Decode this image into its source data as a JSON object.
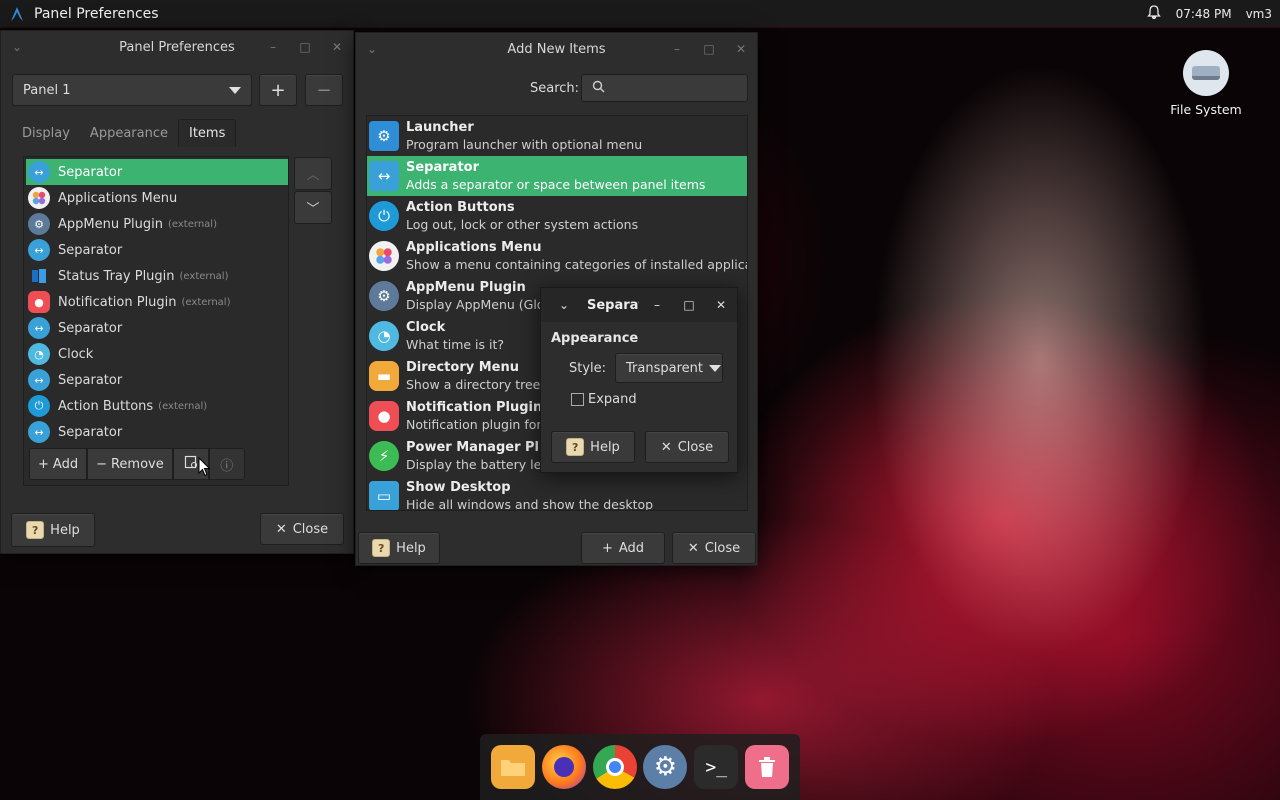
{
  "top_panel": {
    "app_title": "Panel Preferences",
    "clock": "07:48 PM",
    "user": "vm3"
  },
  "desktop": {
    "icon_label": "File System"
  },
  "panel_prefs": {
    "title": "Panel Preferences",
    "panel_select": "Panel 1",
    "tabs": [
      "Display",
      "Appearance",
      "Items"
    ],
    "items": [
      {
        "label": "Separator",
        "ext": ""
      },
      {
        "label": "Applications Menu",
        "ext": ""
      },
      {
        "label": "AppMenu Plugin",
        "ext": "(external)"
      },
      {
        "label": "Separator",
        "ext": ""
      },
      {
        "label": "Status Tray Plugin",
        "ext": "(external)"
      },
      {
        "label": "Notification Plugin",
        "ext": "(external)"
      },
      {
        "label": "Separator",
        "ext": ""
      },
      {
        "label": "Clock",
        "ext": ""
      },
      {
        "label": "Separator",
        "ext": ""
      },
      {
        "label": "Action Buttons",
        "ext": "(external)"
      },
      {
        "label": "Separator",
        "ext": ""
      }
    ],
    "add_label": "Add",
    "remove_label": "Remove",
    "help_label": "Help",
    "close_label": "Close"
  },
  "add_items": {
    "title": "Add New Items",
    "search_label": "Search:",
    "search_value": "",
    "rows": [
      {
        "name": "Launcher",
        "desc": "Program launcher with optional menu"
      },
      {
        "name": "Separator",
        "desc": "Adds a separator or space between panel items"
      },
      {
        "name": "Action Buttons",
        "desc": "Log out, lock or other system actions"
      },
      {
        "name": "Applications Menu",
        "desc": "Show a menu containing categories of installed applicati..."
      },
      {
        "name": "AppMenu Plugin",
        "desc": "Display AppMenu (Glob"
      },
      {
        "name": "Clock",
        "desc": "What time is it?"
      },
      {
        "name": "Directory Menu",
        "desc": "Show a directory tree in"
      },
      {
        "name": "Notification Plugin",
        "desc": "Notification plugin for t"
      },
      {
        "name": "Power Manager Plugin",
        "desc": "Display the battery leve"
      },
      {
        "name": "Show Desktop",
        "desc": "Hide all windows and show the desktop"
      }
    ],
    "help_label": "Help",
    "add_label": "Add",
    "close_label": "Close"
  },
  "separator_dialog": {
    "title": "Separat",
    "section": "Appearance",
    "style_label": "Style:",
    "style_value": "Transparent",
    "expand_label": "Expand",
    "expand_checked": false,
    "help_label": "Help",
    "close_label": "Close"
  },
  "dock": {
    "apps": [
      "file-manager-icon",
      "firefox-icon",
      "chrome-icon",
      "settings-icon",
      "terminal-icon",
      "trash-icon"
    ]
  },
  "colors": {
    "selection": "#3cb371",
    "window_bg": "#2d2d2d",
    "accent_blue": "#3aa0d8"
  }
}
